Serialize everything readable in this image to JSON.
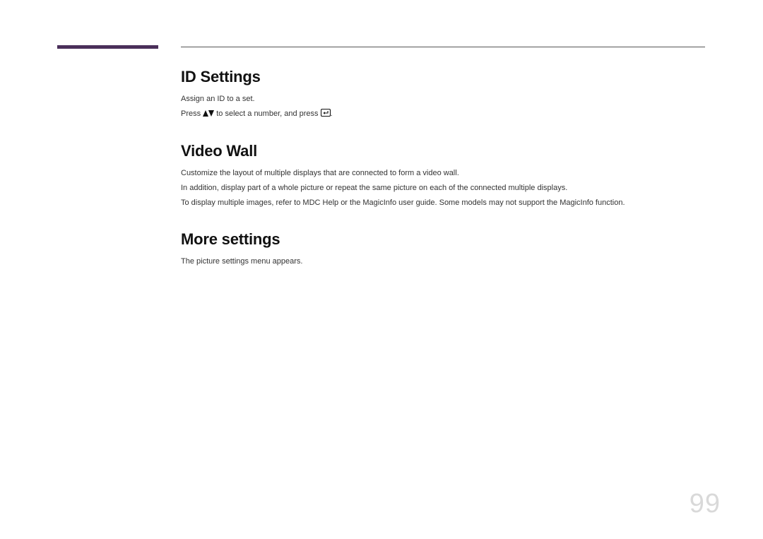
{
  "page_number": "99",
  "sections": {
    "id_settings": {
      "heading": "ID Settings",
      "line1": "Assign an ID to a set.",
      "line2_a": "Press ",
      "line2_b": " to select a number, and press ",
      "line2_c": ".",
      "icon_updown_name": "up-down-arrows-icon",
      "icon_enter_name": "enter-icon"
    },
    "video_wall": {
      "heading": "Video Wall",
      "line1": "Customize the layout of multiple displays that are connected to form a video wall.",
      "line2": "In addition, display part of a whole picture or repeat the same picture on each of the connected multiple displays.",
      "line3": "To display multiple images, refer to MDC Help or the MagicInfo user guide. Some models may not support the MagicInfo function."
    },
    "more_settings": {
      "heading": "More settings",
      "line1": "The picture settings menu appears."
    }
  }
}
